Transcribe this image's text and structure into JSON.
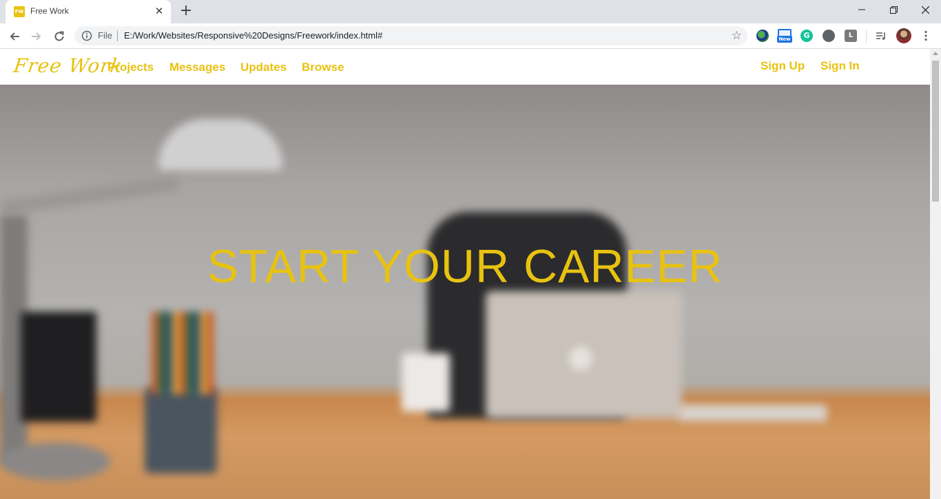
{
  "browser": {
    "tab_title": "Free Work",
    "favicon_text": "FW",
    "scheme_label": "File",
    "url": "E:/Work/Websites/Responsive%20Designs/Freework/index.html#",
    "extensions": [
      "globe-extension-icon",
      "new-screenshot-extension-icon",
      "grammarly-icon",
      "dark-reader-icon",
      "l-extension-icon",
      "playlist-icon",
      "profile-avatar"
    ],
    "new_badge": "New",
    "l_ext_label": "L"
  },
  "site": {
    "brand": "Free Work",
    "nav": {
      "projects": "Projects",
      "messages": "Messages",
      "updates": "Updates",
      "browse": "Browse",
      "sign_up": "Sign Up",
      "sign_in": "Sign In"
    },
    "hero_headline": "START YOUR CAREER"
  },
  "colors": {
    "accent": "#e8c210",
    "chrome_tabbar": "#dee1e6",
    "omnibox": "#f1f3f4"
  }
}
